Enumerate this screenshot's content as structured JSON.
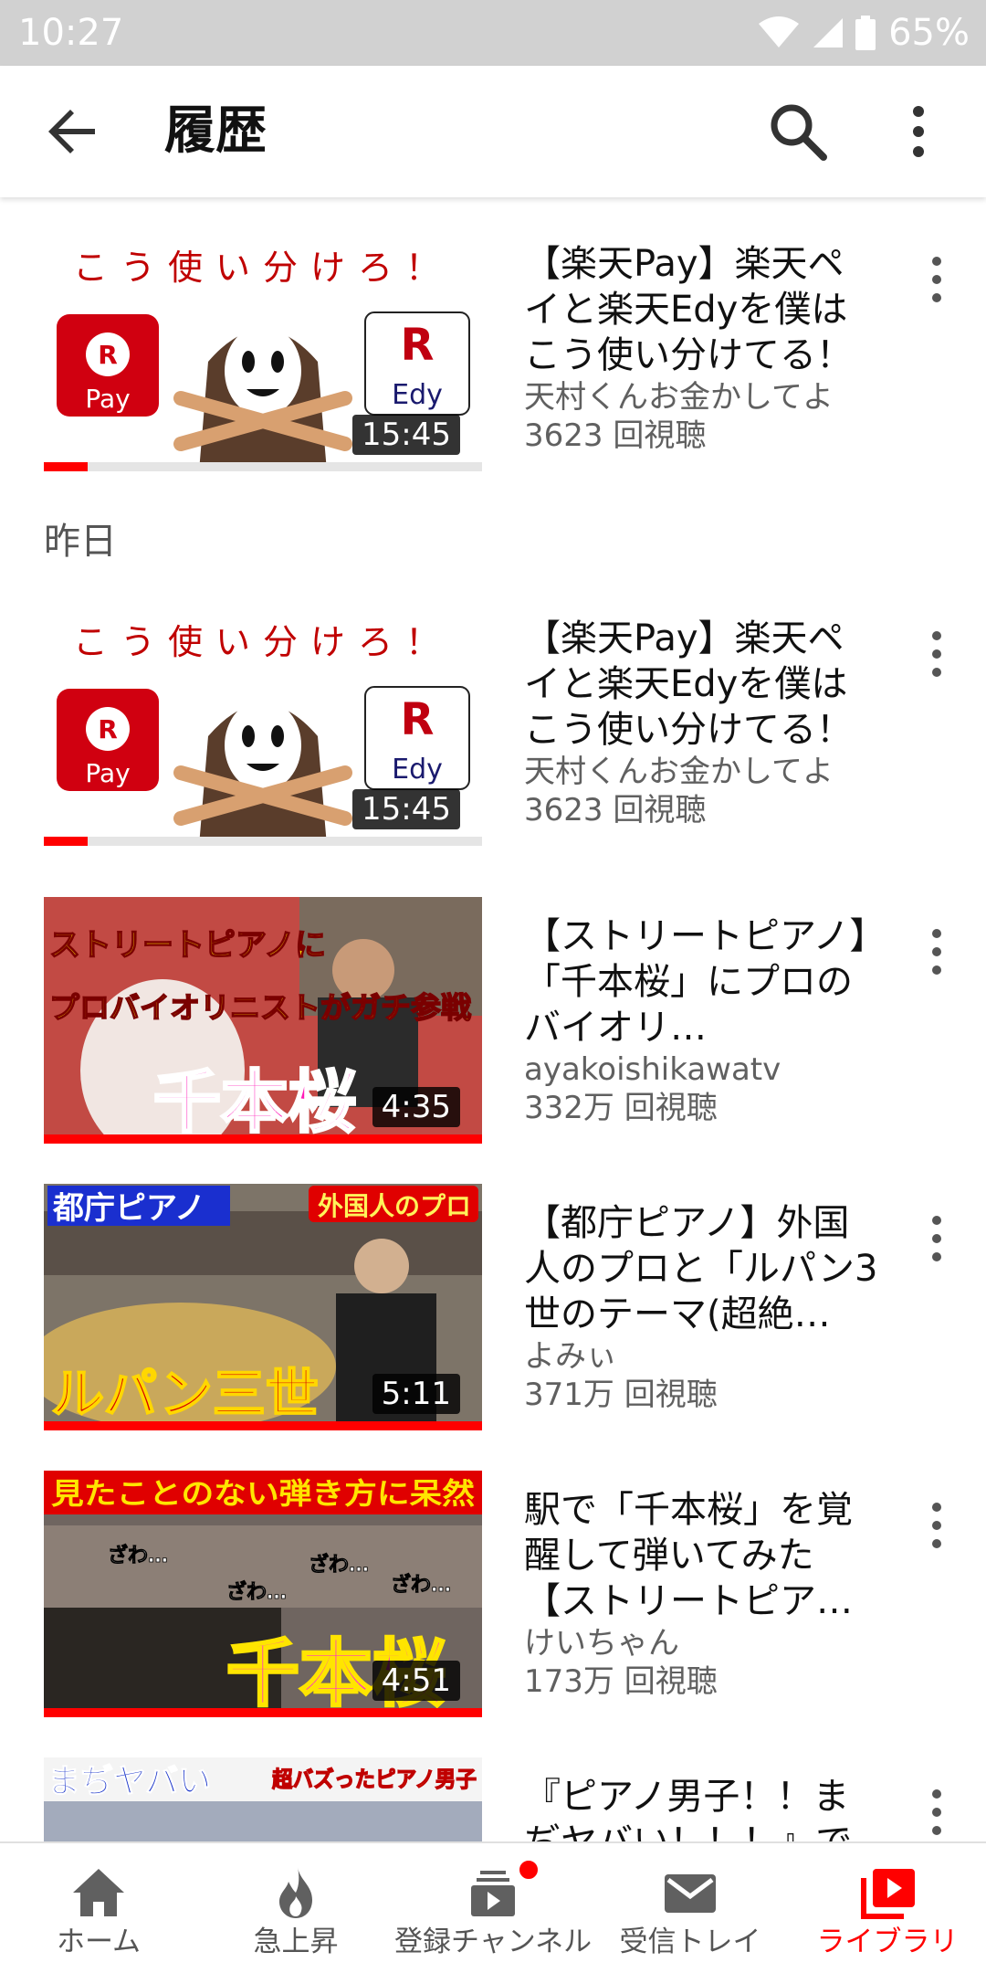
{
  "status_bar": {
    "time": "10:27",
    "battery": "65%",
    "icons": [
      "wifi-icon",
      "cell-signal-icon",
      "battery-icon"
    ]
  },
  "app_bar": {
    "title": "履歴",
    "icons": [
      "back-arrow-icon",
      "search-icon",
      "more-vert-icon"
    ]
  },
  "history": {
    "section_yesterday": "昨日",
    "videos": [
      {
        "title": "【楽天Pay】楽天ペイと楽天Edyを僕はこう使い分けてる！",
        "channel": "天村くんお金かしてよ",
        "views": "3623 回視聴",
        "duration": "15:45",
        "thumb_text": "こう使い分けろ！",
        "thumb_logo_left": "Pay",
        "thumb_logo_right": "Edy",
        "progress": 0.1
      },
      {
        "title": "【楽天Pay】楽天ペイと楽天Edyを僕はこう使い分けてる！",
        "channel": "天村くんお金かしてよ",
        "views": "3623 回視聴",
        "duration": "15:45",
        "thumb_text": "こう使い分けろ！",
        "thumb_logo_left": "Pay",
        "thumb_logo_right": "Edy",
        "progress": 0.1
      },
      {
        "title": "【ストリートピアノ】「千本桜」にプロのバイオリ…",
        "channel": "ayakoishikawatv",
        "views": "332万 回視聴",
        "duration": "4:35",
        "thumb_text_top": "ストリートピアノに",
        "thumb_text_mid": "プロバイオリニストがガチ参戦",
        "thumb_text_big": "千本桜",
        "progress": 1.0
      },
      {
        "title": "【都庁ピアノ】外国人のプロと「ルパン3世のテーマ(超絶…",
        "channel": "よみぃ",
        "views": "371万 回視聴",
        "duration": "5:11",
        "thumb_text_top": "都庁ピアノ",
        "thumb_text_tag": "外国人のプロ",
        "thumb_text_big": "ルパン三世",
        "progress": 1.0
      },
      {
        "title": "駅で「千本桜」を覚醒して弾いてみた【ストリートピア…",
        "channel": "けいちゃん",
        "views": "173万 回視聴",
        "duration": "4:51",
        "thumb_text_top": "見たことのない弾き方に呆然",
        "thumb_text_small": "ざわ…",
        "thumb_text_big": "千本桜",
        "progress": 1.0
      },
      {
        "title": "『ピアノ男子！！まぢヤバい！！！』で",
        "thumb_text_top": "まぢヤバい",
        "thumb_text_tag": "超バズったピアノ男子"
      }
    ]
  },
  "bottom_nav": {
    "items": [
      {
        "label": "ホーム",
        "icon": "home-icon"
      },
      {
        "label": "急上昇",
        "icon": "trending-flame-icon"
      },
      {
        "label": "登録チャンネル",
        "icon": "subscriptions-icon"
      },
      {
        "label": "受信トレイ",
        "icon": "inbox-mail-icon"
      },
      {
        "label": "ライブラリ",
        "icon": "library-icon"
      }
    ],
    "active_index": 4,
    "colors": {
      "active": "#ff0000",
      "inactive": "#606060"
    }
  }
}
